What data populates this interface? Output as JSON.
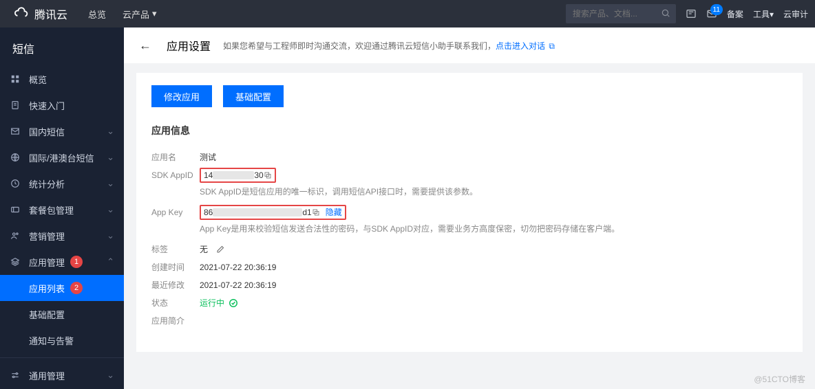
{
  "header": {
    "brand": "腾讯云",
    "nav": [
      "总览",
      "云产品"
    ],
    "search_placeholder": "搜索产品、文档...",
    "msg_badge": "11",
    "links": [
      "备案",
      "工具",
      "云审计"
    ]
  },
  "sidebar": {
    "title": "短信",
    "items": [
      {
        "icon": "grid",
        "label": "概览"
      },
      {
        "icon": "doc",
        "label": "快速入门"
      },
      {
        "icon": "mail",
        "label": "国内短信",
        "chev": true
      },
      {
        "icon": "globe",
        "label": "国际/港澳台短信",
        "chev": true
      },
      {
        "icon": "clock",
        "label": "统计分析",
        "chev": true
      },
      {
        "icon": "ticket",
        "label": "套餐包管理",
        "chev": true
      },
      {
        "icon": "people",
        "label": "营销管理",
        "chev": true
      },
      {
        "icon": "stack",
        "label": "应用管理",
        "chev": true,
        "badge": "1",
        "open": true,
        "children": [
          {
            "label": "应用列表",
            "badge": "2",
            "active": true
          },
          {
            "label": "基础配置"
          },
          {
            "label": "通知与告警"
          }
        ]
      },
      {
        "icon": "sliders",
        "label": "通用管理",
        "chev": true
      }
    ]
  },
  "page": {
    "title": "应用设置",
    "notice_pre": "如果您希望与工程师即时沟通交流，欢迎通过腾讯云短信小助手联系我们，",
    "notice_link": "点击进入对话",
    "buttons": {
      "edit": "修改应用",
      "config": "基础配置"
    },
    "section_title": "应用信息",
    "rows": {
      "app_name_label": "应用名",
      "app_name_value": "测试",
      "sdk_label": "SDK AppID",
      "sdk_prefix": "14",
      "sdk_suffix": "30",
      "sdk_desc": "SDK AppID是短信应用的唯一标识，调用短信API接口时，需要提供该参数。",
      "appkey_label": "App Key",
      "appkey_prefix": "86",
      "appkey_suffix": "d1",
      "appkey_hide": "隐藏",
      "appkey_desc": "App Key是用来校验短信发送合法性的密码，与SDK AppID对应，需要业务方高度保密，切勿把密码存储在客户端。",
      "tag_label": "标签",
      "tag_value": "无",
      "created_label": "创建时间",
      "created_value": "2021-07-22 20:36:19",
      "modified_label": "最近修改",
      "modified_value": "2021-07-22 20:36:19",
      "status_label": "状态",
      "status_value": "运行中",
      "brief_label": "应用简介"
    }
  },
  "watermark": "@51CTO博客"
}
